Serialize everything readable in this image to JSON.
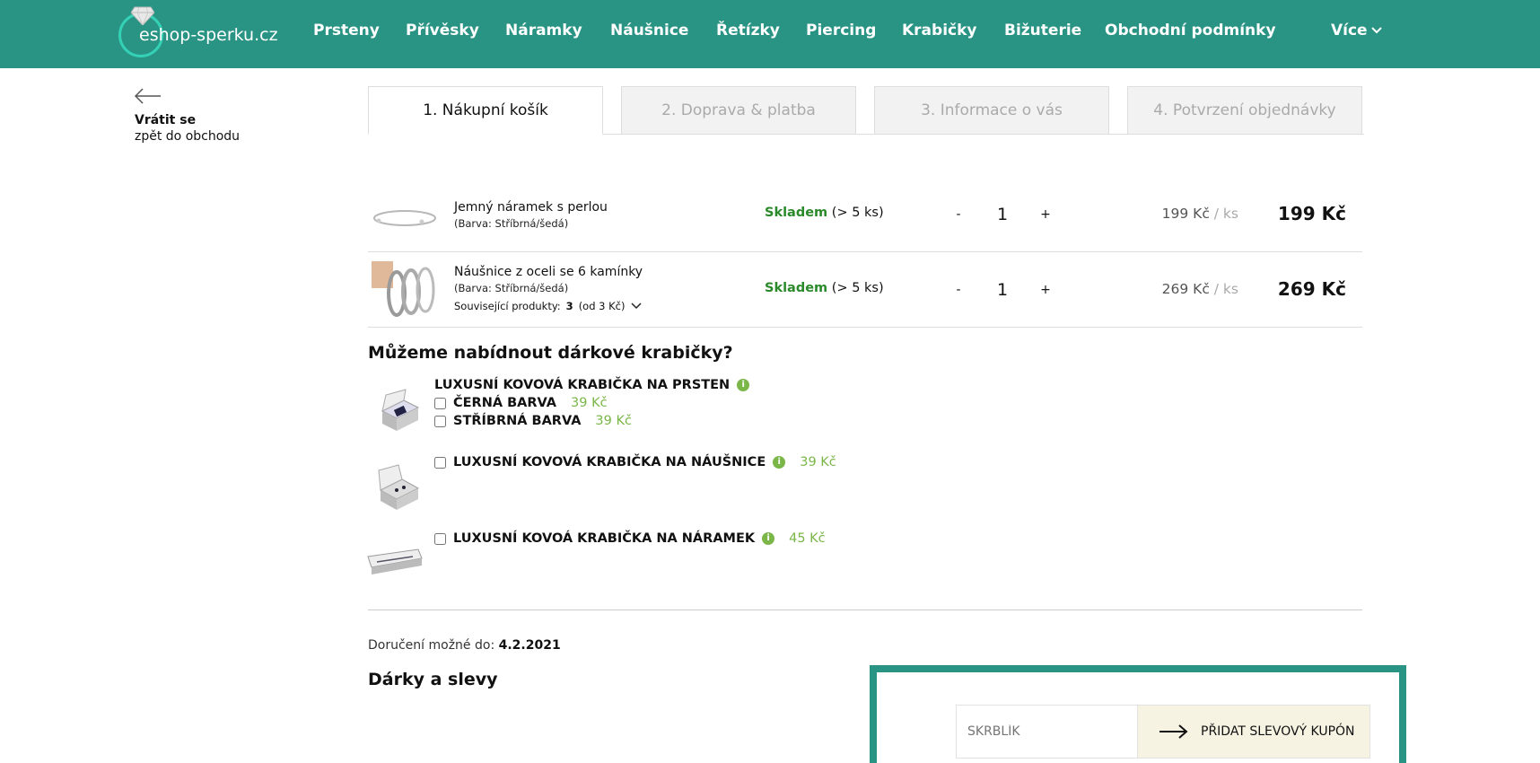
{
  "header": {
    "logo_text": "eshop-sperku.cz",
    "nav": [
      "Prsteny",
      "Přívěsky",
      "Náramky",
      "Náušnice",
      "Řetízky",
      "Piercing",
      "Krabičky",
      "Bižuterie",
      "Obchodní podmínky"
    ],
    "more_label": "Více",
    "bg_color": "#2a9484"
  },
  "back": {
    "title": "Vrátit se",
    "subtitle": "zpět do obchodu"
  },
  "steps": [
    "1. Nákupní košík",
    "2. Doprava & platba",
    "3. Informace o vás",
    "4. Potvrzení objednávky"
  ],
  "active_step": 1,
  "cart": {
    "items": [
      {
        "name": "Jemný náramek s perlou",
        "variant": "(Barva: Stříbrná/šedá)",
        "stock_label": "Skladem",
        "stock_qty": "(> 5 ks)",
        "qty": "1",
        "unit_price": "199 Kč",
        "per_unit": " / ks",
        "total": "199 Kč"
      },
      {
        "name": "Náušnice z oceli se 6 kamínky",
        "variant": "(Barva: Stříbrná/šedá)",
        "related_label": "Související produkty:",
        "related_count": "3",
        "related_from": "(od 3 Kč)",
        "stock_label": "Skladem",
        "stock_qty": "(> 5 ks)",
        "qty": "1",
        "unit_price": "269 Kč",
        "per_unit": " / ks",
        "total": "269 Kč"
      }
    ],
    "minus": "-",
    "plus": "+"
  },
  "gift": {
    "heading": "Můžeme nabídnout dárkové krabičky?",
    "ring_box_title": "LUXUSNÍ KOVOVÁ KRABIČKA NA PRSTEN",
    "ring_options": [
      {
        "label": "ČERNÁ BARVA",
        "price": "39 Kč"
      },
      {
        "label": "STŘÍBRNÁ BARVA",
        "price": "39 Kč"
      }
    ],
    "earring_box": {
      "label": "LUXUSNÍ KOVOVÁ KRABIČKA NA NÁUŠNICE",
      "price": "39 Kč"
    },
    "bracelet_box": {
      "label": "LUXUSNÍ KOVOÁ KRABIČKA NA NÁRAMEK",
      "price": "45 Kč"
    },
    "info_glyph": "i"
  },
  "delivery": {
    "label": "Doručení možné do:",
    "date": "4.2.2021"
  },
  "discounts": {
    "heading": "Dárky a slevy",
    "coupon_placeholder": "SKRBLÍK",
    "coupon_button": "PŘIDAT SLEVOVÝ KUPÓN"
  }
}
